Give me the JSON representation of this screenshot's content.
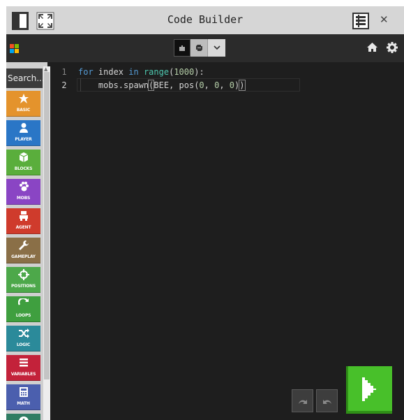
{
  "titlebar": {
    "title": "Code Builder",
    "close_glyph": "✕"
  },
  "toolbar": {
    "logo_colors": [
      "#f25022",
      "#7fba00",
      "#00a4ef",
      "#ffb900"
    ],
    "modes": [
      "blocks",
      "python"
    ],
    "selected_mode": "python"
  },
  "sidebar": {
    "search_label": "Search...",
    "categories": [
      {
        "label": "BASIC",
        "color": "#e4932c",
        "icon": "star-icon"
      },
      {
        "label": "PLAYER",
        "color": "#2a76c6",
        "icon": "person-icon"
      },
      {
        "label": "BLOCKS",
        "color": "#5aae3c",
        "icon": "cube-icon"
      },
      {
        "label": "MOBS",
        "color": "#8a45c4",
        "icon": "paw-icon"
      },
      {
        "label": "AGENT",
        "color": "#cf3b2c",
        "icon": "agent-icon"
      },
      {
        "label": "GAMEPLAY",
        "color": "#8a6f47",
        "icon": "wrench-icon"
      },
      {
        "label": "POSITIONS",
        "color": "#4da84a",
        "icon": "crosshair-icon"
      },
      {
        "label": "LOOPS",
        "color": "#3f9f3f",
        "icon": "loop-icon"
      },
      {
        "label": "LOGIC",
        "color": "#2b8a9a",
        "icon": "shuffle-icon"
      },
      {
        "label": "VARIABLES",
        "color": "#c3223a",
        "icon": "list-icon"
      },
      {
        "label": "MATH",
        "color": "#4b5fae",
        "icon": "calculator-icon"
      },
      {
        "label": "",
        "color": "#2f7d63",
        "icon": "plus-icon"
      }
    ]
  },
  "editor": {
    "lines": [
      {
        "number": "1",
        "parts": [
          {
            "t": "for",
            "c": "kw"
          },
          {
            "t": " index ",
            "c": ""
          },
          {
            "t": "in",
            "c": "kw"
          },
          {
            "t": " ",
            "c": ""
          },
          {
            "t": "range",
            "c": "fn"
          },
          {
            "t": "(",
            "c": ""
          },
          {
            "t": "1000",
            "c": "num"
          },
          {
            "t": "):",
            "c": ""
          }
        ]
      },
      {
        "number": "2",
        "parts": [
          {
            "t": "    mobs.spawn",
            "c": ""
          },
          {
            "t": "(",
            "c": "bracket"
          },
          {
            "t": "BEE, pos(",
            "c": ""
          },
          {
            "t": "0",
            "c": "num"
          },
          {
            "t": ", ",
            "c": ""
          },
          {
            "t": "0",
            "c": "num"
          },
          {
            "t": ", ",
            "c": ""
          },
          {
            "t": "0",
            "c": "num"
          },
          {
            "t": ")",
            "c": ""
          },
          {
            "t": ")",
            "c": "bracket"
          }
        ]
      }
    ]
  },
  "controls": {
    "undo": "undo-icon",
    "redo": "redo-icon",
    "run": "run-icon",
    "run_color": "#48c02a"
  }
}
